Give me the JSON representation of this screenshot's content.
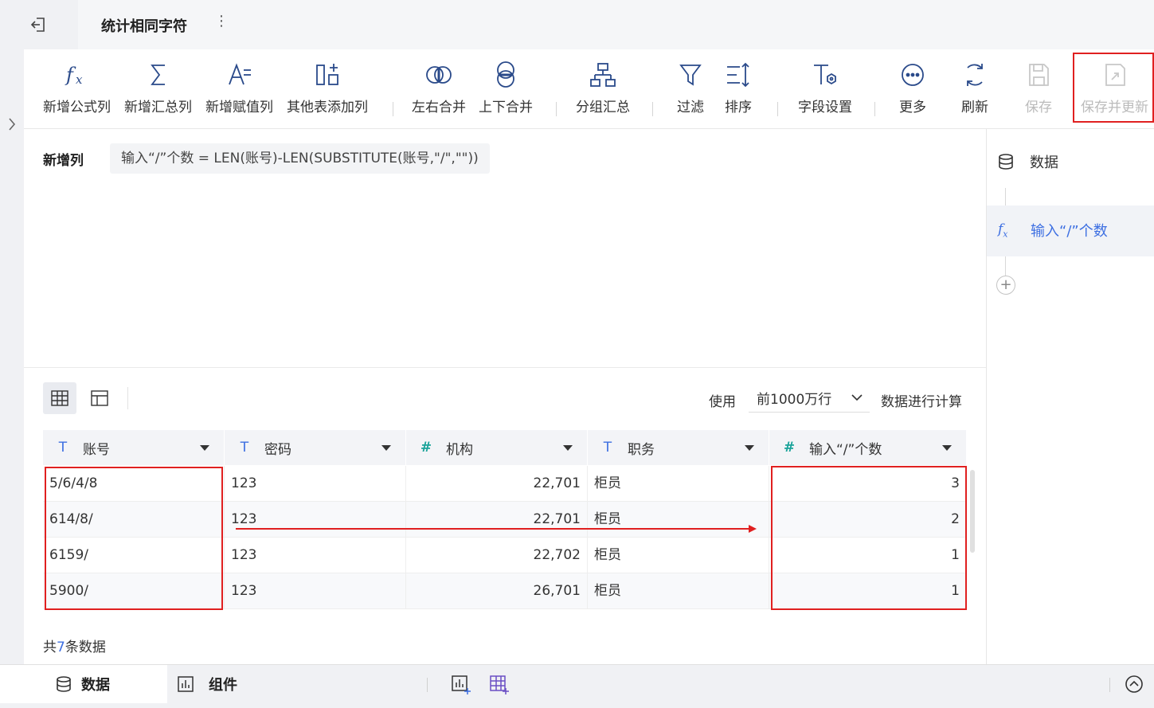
{
  "title": "统计相同字符",
  "title_more": "⋮",
  "toolbar": {
    "new_formula_col": "新增公式列",
    "new_summary_col": "新增汇总列",
    "new_assign_col": "新增赋值列",
    "add_from_other_table": "其他表添加列",
    "merge_lr": "左右合并",
    "merge_ud": "上下合并",
    "group_summary": "分组汇总",
    "filter": "过滤",
    "sort": "排序",
    "field_settings": "字段设置",
    "more": "更多",
    "refresh": "刷新",
    "save": "保存",
    "save_and_update": "保存并更新"
  },
  "editor": {
    "label": "新增列",
    "formula": "输入“/”个数 = LEN(账号)-LEN(SUBSTITUTE(账号,\"/\",\"\"))"
  },
  "right_panel": {
    "data_step": "数据",
    "formula_step": "输入“/”个数",
    "add": "+"
  },
  "preview": {
    "use_label": "使用",
    "range_value": "前1000万行",
    "calc_label": "数据进行计算",
    "columns": [
      {
        "name": "账号",
        "type": "text"
      },
      {
        "name": "密码",
        "type": "text"
      },
      {
        "name": "机构",
        "type": "number"
      },
      {
        "name": "职务",
        "type": "text"
      },
      {
        "name": "输入“/”个数",
        "type": "number"
      }
    ],
    "rows": [
      [
        "5/6/4/8",
        "123",
        "22,701",
        "柜员",
        "3"
      ],
      [
        "614/8/",
        "123",
        "22,701",
        "柜员",
        "2"
      ],
      [
        "6159/",
        "123",
        "22,702",
        "柜员",
        "1"
      ],
      [
        "5900/",
        "123",
        "26,701",
        "柜员",
        "1"
      ]
    ],
    "count_prefix": "共",
    "count_value": "7",
    "count_suffix": "条数据"
  },
  "bottom": {
    "tab_data": "数据",
    "tab_component": "组件"
  },
  "colors": {
    "accent": "#3d6fe2",
    "number_type": "#1aa39a",
    "highlight": "#e02020"
  }
}
